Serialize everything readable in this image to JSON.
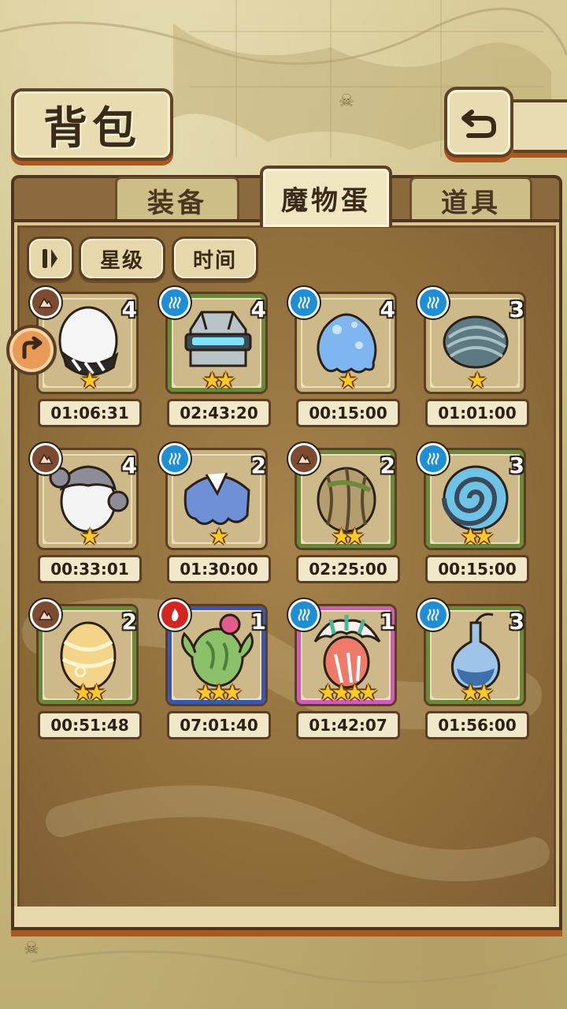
{
  "header": {
    "title": "背包"
  },
  "tabs": [
    {
      "label": "装备",
      "active": false
    },
    {
      "label": "魔物蛋",
      "active": true
    },
    {
      "label": "道具",
      "active": false
    }
  ],
  "filters": {
    "toggle_icon": "pause-bars-icon",
    "star_label": "星级",
    "time_label": "时间"
  },
  "eggs": [
    {
      "element": "earth",
      "count": "4",
      "stars": 1,
      "timer": "01:06:31",
      "rim": "#c7b27d",
      "egg": "white-striped"
    },
    {
      "element": "water",
      "count": "4",
      "stars": 2,
      "timer": "02:43:20",
      "rim": "#6a8a3a",
      "egg": "robot"
    },
    {
      "element": "water",
      "count": "4",
      "stars": 1,
      "timer": "00:15:00",
      "rim": "#c7b27d",
      "egg": "slime"
    },
    {
      "element": "water",
      "count": "3",
      "stars": 1,
      "timer": "01:01:00",
      "rim": "#c7b27d",
      "egg": "shell"
    },
    {
      "element": "earth",
      "count": "4",
      "stars": 1,
      "timer": "00:33:01",
      "rim": "#c7b27d",
      "egg": "koala"
    },
    {
      "element": "water",
      "count": "2",
      "stars": 1,
      "timer": "01:30:00",
      "rim": "#c7b27d",
      "egg": "fluffy-blue"
    },
    {
      "element": "earth",
      "count": "2",
      "stars": 2,
      "timer": "02:25:00",
      "rim": "#6a8a3a",
      "egg": "wrapped"
    },
    {
      "element": "water",
      "count": "3",
      "stars": 2,
      "timer": "00:15:00",
      "rim": "#6a8a3a",
      "egg": "spiral"
    },
    {
      "element": "earth",
      "count": "2",
      "stars": 2,
      "timer": "00:51:48",
      "rim": "#6a8a3a",
      "egg": "golden"
    },
    {
      "element": "fire",
      "count": "1",
      "stars": 3,
      "timer": "07:01:40",
      "rim": "#3a55b4",
      "egg": "cactus"
    },
    {
      "element": "water",
      "count": "1",
      "stars": 4,
      "timer": "01:42:07",
      "rim": "#d25db8",
      "egg": "feather"
    },
    {
      "element": "water",
      "count": "3",
      "stars": 2,
      "timer": "01:56:00",
      "rim": "#6a8a3a",
      "egg": "flask"
    }
  ]
}
